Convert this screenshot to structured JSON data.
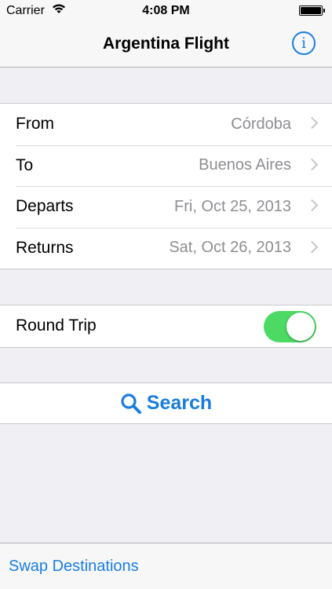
{
  "status_bar": {
    "carrier": "Carrier",
    "time": "4:08 PM",
    "battery_level": 1.0
  },
  "nav": {
    "title": "Argentina Flight",
    "info_label": "i"
  },
  "trip": {
    "rows": [
      {
        "label": "From",
        "value": "Córdoba"
      },
      {
        "label": "To",
        "value": "Buenos Aires"
      },
      {
        "label": "Departs",
        "value": "Fri, Oct 25, 2013"
      },
      {
        "label": "Returns",
        "value": "Sat, Oct 26, 2013"
      }
    ]
  },
  "options": {
    "round_trip_label": "Round Trip",
    "round_trip_on": true
  },
  "search": {
    "label": "Search"
  },
  "toolbar": {
    "swap_label": "Swap Destinations"
  },
  "colors": {
    "accent": "#1a7ddb",
    "toggle_on": "#4cd964",
    "secondary_text": "#8e8e93",
    "background": "#efeff4"
  }
}
